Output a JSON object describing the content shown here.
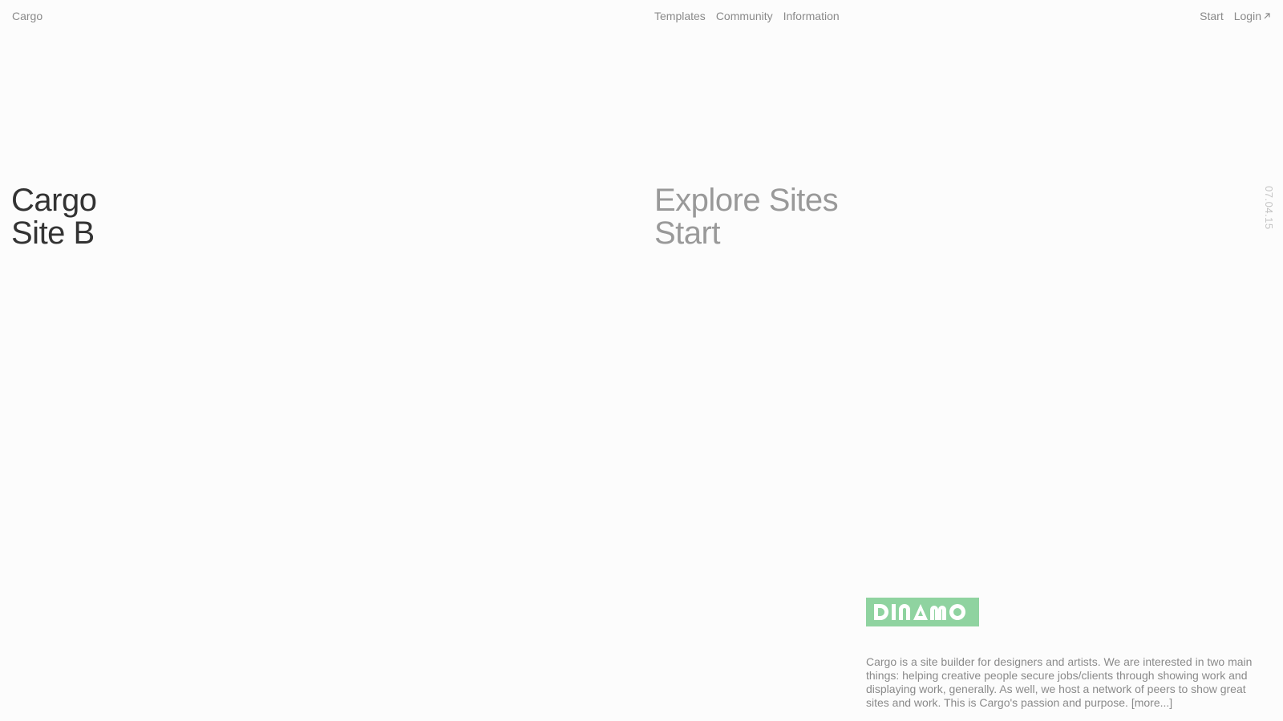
{
  "header": {
    "brand": "Cargo",
    "nav_center": [
      "Templates",
      "Community",
      "Information"
    ],
    "nav_right": {
      "start": "Start",
      "login": "Login"
    }
  },
  "hero": {
    "left_lines": [
      "Cargo",
      "Site B"
    ],
    "right_links": [
      "Explore Sites",
      "Start"
    ]
  },
  "date_stamp": "07.04.15",
  "logo": {
    "text": "DINAMO",
    "color": "#8fd3a0"
  },
  "about": {
    "text": "Cargo is a site builder for designers and artists. We are interested in two main things: helping creative people secure jobs/clients through showing work and displaying work, generally. As well, we host a network of peers to show great sites and work. This is Cargo's passion and purpose.",
    "more_link": "[more...]"
  },
  "icons": {
    "login_arrow": "arrow-up-right-icon"
  }
}
